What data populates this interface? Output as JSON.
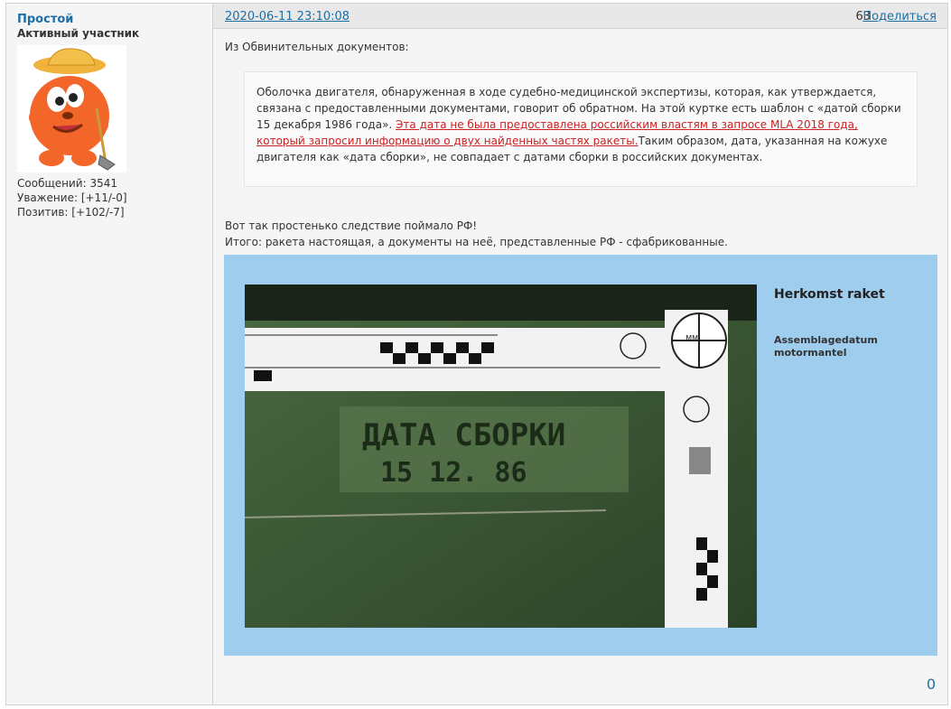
{
  "author": {
    "username": "Простой",
    "title": "Активный участник",
    "stats": {
      "messages": "Сообщений: 3541",
      "respect": "Уважение: [+11/-0]",
      "positive": "Позитив: [+102/-7]"
    }
  },
  "post": {
    "datetime": "2020-06-11 23:10:08",
    "number": "63",
    "share_label": "Поделиться",
    "intro": "Из Обвинительных документов:",
    "quote": {
      "text_before": "Оболочка двигателя, обнаруженная в ходе судебно-медицинской экспертизы, которая, как утверждается, связана с предоставленными документами, говорит об обратном. На этой куртке есть шаблон с «датой сборки 15 декабря 1986 года». ",
      "link_text": "Эта дата не была предоставлена российским властям в запросе MLA 2018 года, который запросил информацию о двух найденных частях ракеты.",
      "text_after": "Таким образом, дата, указанная на кожухе двигателя как «дата сборки», не совпадает с датами сборки в российских документах."
    },
    "line1": "Вот так простенько следствие поймало  РФ!",
    "line2": "Итого: ракета настоящая, а документы на неё, представленные РФ - сфабрикованные.",
    "image": {
      "title": "Herkomst raket",
      "subtitle_line1": "Assemblagedatum",
      "subtitle_line2": "motormantel",
      "stencil_line1": "ДАТА СБОРКИ",
      "stencil_line2": "15   12. 86",
      "ruler_unit": "MM"
    },
    "like_count": "0"
  },
  "colors": {
    "link": "#1d6fa5",
    "quote_link": "#cc2222",
    "image_bg": "#9fcdee",
    "photo_green": "#3f5a38"
  }
}
